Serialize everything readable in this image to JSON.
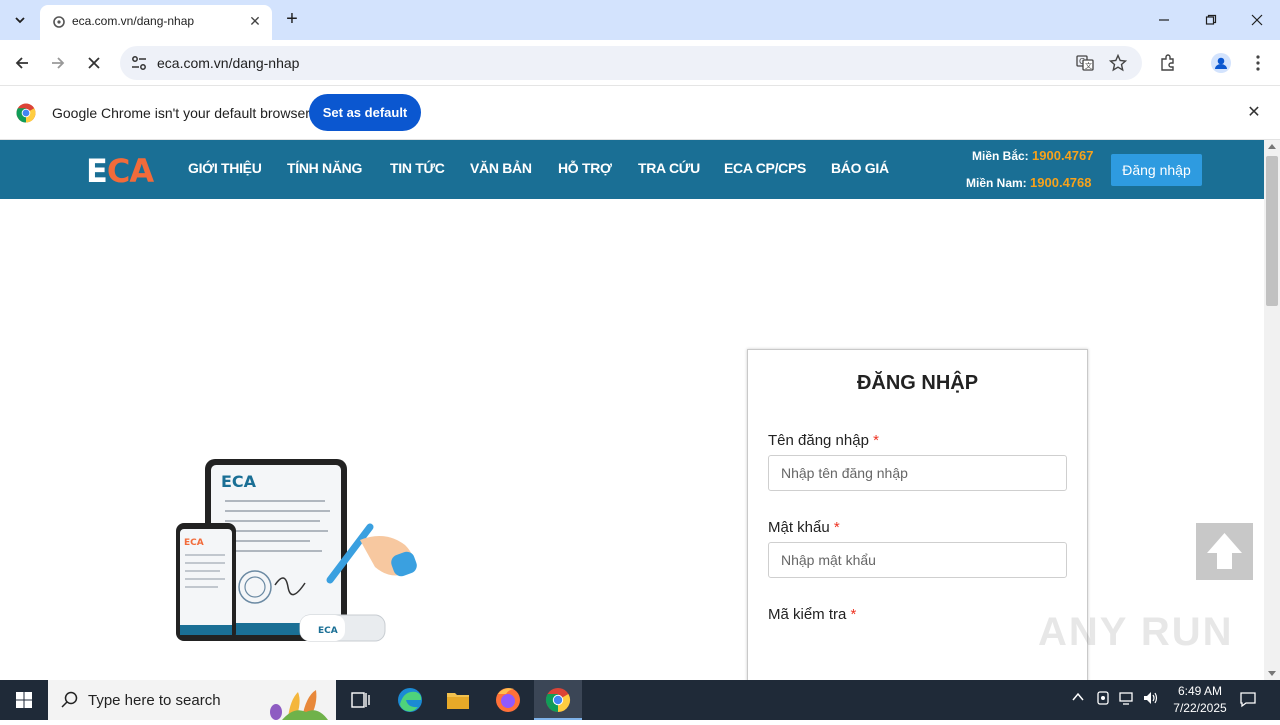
{
  "browser": {
    "tab_title": "eca.com.vn/dang-nhap",
    "url": "eca.com.vn/dang-nhap",
    "infobar_message": "Google Chrome isn't your default browser",
    "infobar_button": "Set as default"
  },
  "site": {
    "logo_e": "E",
    "logo_ca": "CA",
    "menu": [
      "GIỚI THIỆU",
      "TÍNH NĂNG",
      "TIN TỨC",
      "VĂN BẢN",
      "HỖ TRỢ",
      "TRA CỨU",
      "ECA CP/CPS",
      "BÁO GIÁ"
    ],
    "hotline_north_label": "Miền Bắc:",
    "hotline_north_number": "1900.4767",
    "hotline_south_label": "Miền Nam:",
    "hotline_south_number": "1900.4768",
    "login_button": "Đăng nhập",
    "illustration_logo": "ECA"
  },
  "login_form": {
    "title": "ĐĂNG NHẬP",
    "username_label": "Tên đăng nhập",
    "username_placeholder": "Nhập tên đăng nhập",
    "password_label": "Mật khẩu",
    "password_placeholder": "Nhập mật khẩu",
    "captcha_label": "Mã kiểm tra",
    "required_mark": "*"
  },
  "watermark": "ANY RUN",
  "taskbar": {
    "search_placeholder": "Type here to search",
    "time": "6:49 AM",
    "date": "7/22/2025"
  },
  "colors": {
    "site_header": "#1a6f95",
    "accent_orange": "#f26b3a",
    "hotline_number": "#f7a21b",
    "login_button": "#2e9be0",
    "chrome_primary": "#0b57d0"
  }
}
